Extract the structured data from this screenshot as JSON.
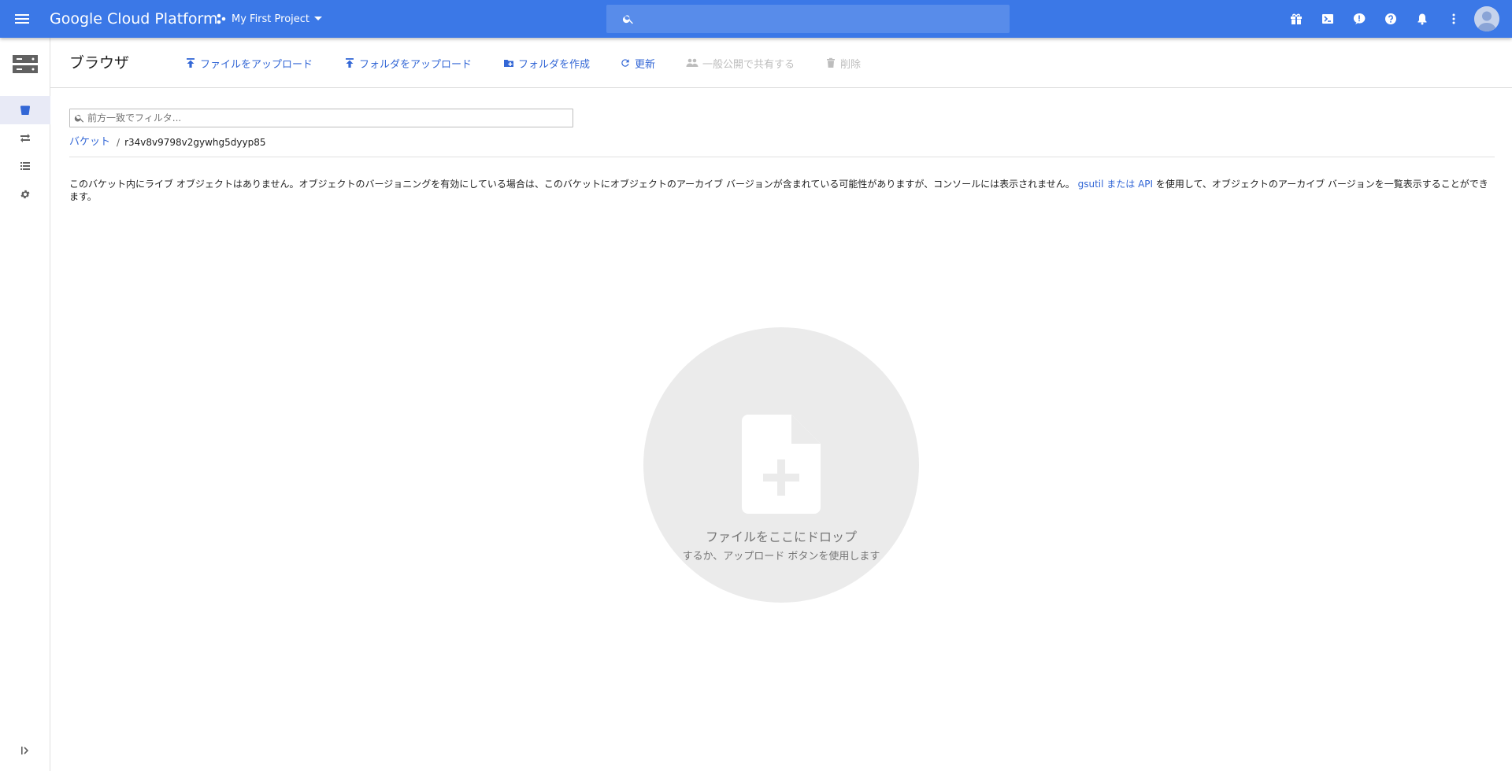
{
  "appbar": {
    "brand": "Google Cloud Platform",
    "project_name": "My First Project",
    "search_placeholder": "",
    "icons": [
      "menu-icon",
      "gift-icon",
      "cloud-shell-icon",
      "feedback-icon",
      "help-icon",
      "notifications-icon",
      "more-vert-icon",
      "account-avatar"
    ]
  },
  "header": {
    "title": "ブラウザ",
    "actions": {
      "upload_files": "ファイルをアップロード",
      "upload_folder": "フォルダをアップロード",
      "create_folder": "フォルダを作成",
      "refresh": "更新",
      "share_publicly": "一般公開で共有する",
      "delete": "削除"
    }
  },
  "filter": {
    "placeholder": "前方一致でフィルタ..."
  },
  "breadcrumb": {
    "root": "バケット",
    "separator": "/",
    "current": "r34v8v9798v2gywhg5dyyp85"
  },
  "notice": {
    "text_before": "このバケット内にライブ オブジェクトはありません。オブジェクトのバージョニングを有効にしている場合は、このバケットにオブジェクトのアーカイブ バージョンが含まれている可能性がありますが、コンソールには表示されません。",
    "link": "gsutil または API",
    "text_after": " を使用して、オブジェクトのアーカイブ バージョンを一覧表示することができます。"
  },
  "dropzone": {
    "title": "ファイルをここにドロップ",
    "subtitle": "するか、アップロード ボタンを使用します"
  },
  "colors": {
    "appbar": "#3b78e7",
    "link": "#3367d6",
    "disabled": "#bdbdbd",
    "dropzone": "#ebebeb"
  }
}
